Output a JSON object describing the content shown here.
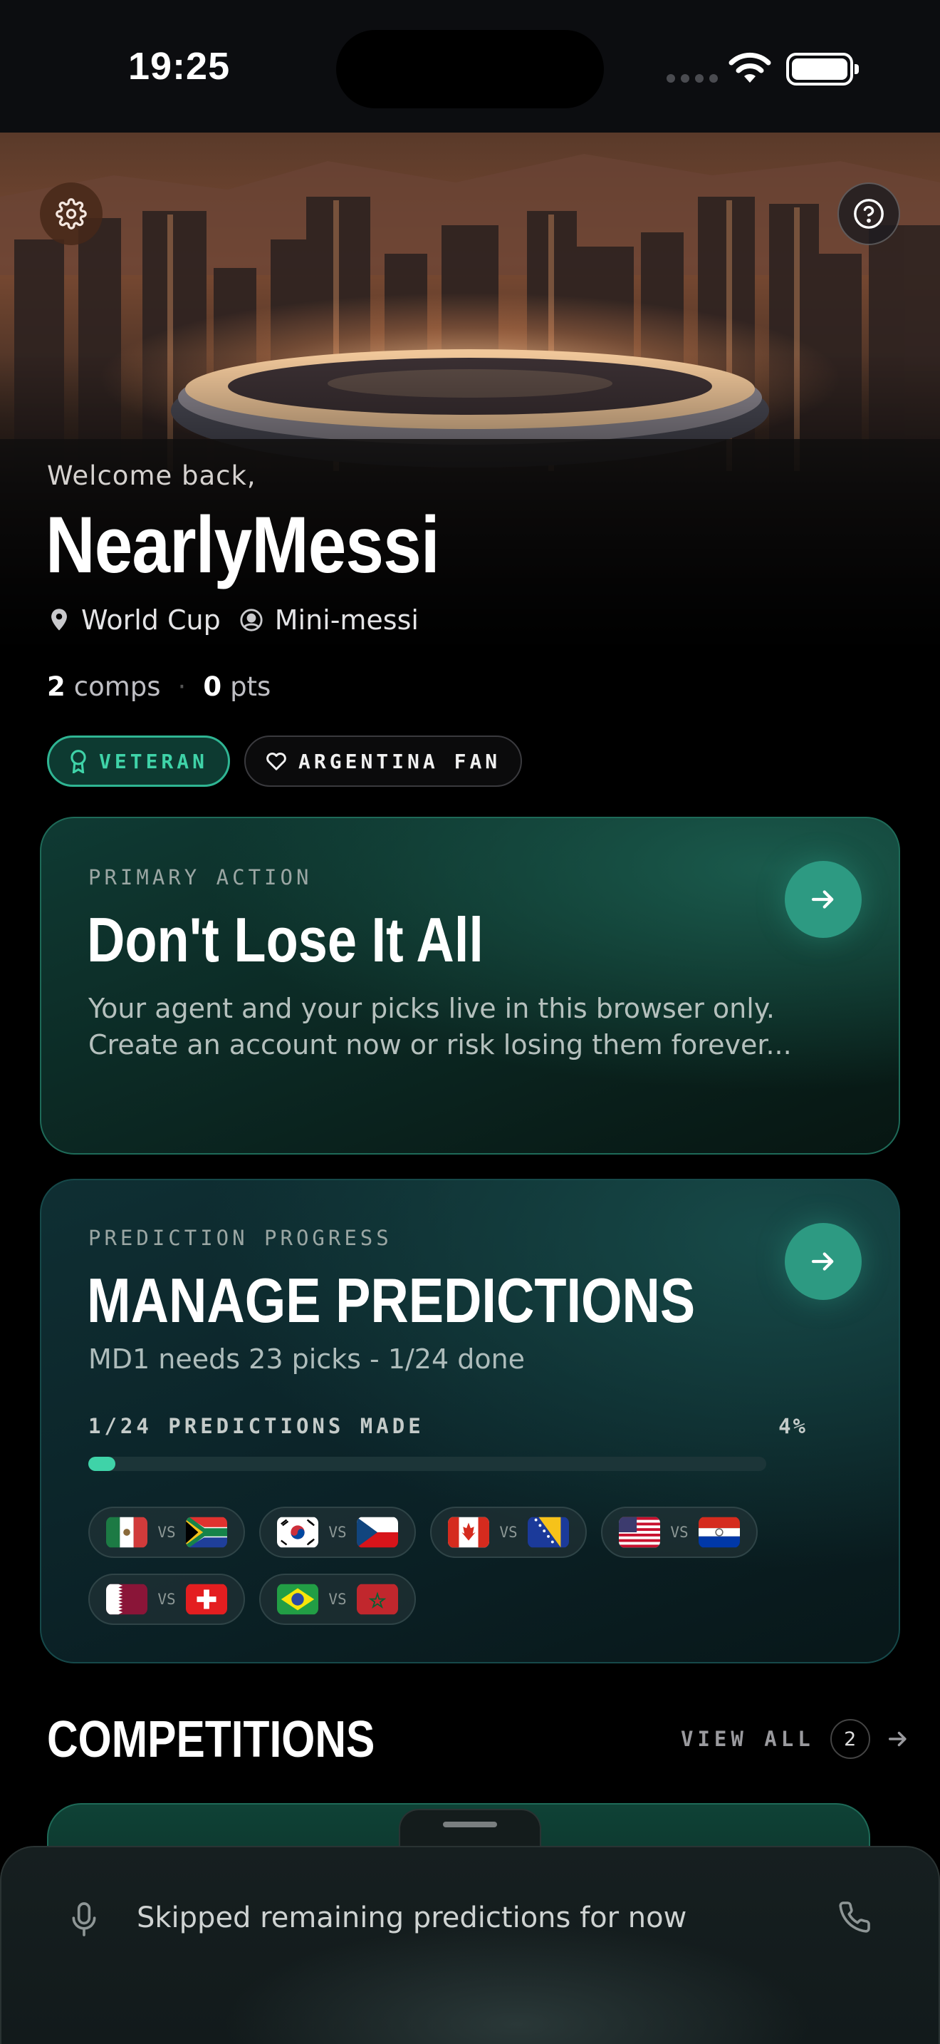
{
  "status_bar": {
    "time": "19:25"
  },
  "header": {
    "welcome": "Welcome back,",
    "username": "NearlyMessi",
    "location": "World Cup",
    "role": "Mini-messi"
  },
  "stats": {
    "comps_value": "2",
    "comps_label": "comps",
    "pts_value": "0",
    "pts_label": "pts"
  },
  "badges": [
    {
      "label": "VETERAN",
      "icon": "award-icon"
    },
    {
      "label": "ARGENTINA FAN",
      "icon": "heart-icon"
    }
  ],
  "primary_card": {
    "kicker": "PRIMARY ACTION",
    "title": "Don't Lose It All",
    "body": "Your agent and your picks live in this browser only. Create an account now or risk losing them forever..."
  },
  "prediction_card": {
    "kicker": "PREDICTION PROGRESS",
    "title": "MANAGE PREDICTIONS",
    "subtitle": "MD1 needs 23 picks - 1/24 done",
    "progress_label": "1/24 PREDICTIONS MADE",
    "progress_percent": "4%",
    "progress_fraction": 0.04,
    "vs_label": "VS",
    "matches": [
      {
        "home": "Mexico",
        "away": "South Africa"
      },
      {
        "home": "South Korea",
        "away": "Czech Republic"
      },
      {
        "home": "Canada",
        "away": "Bosnia and Herzegovina"
      },
      {
        "home": "United States",
        "away": "Paraguay"
      },
      {
        "home": "Qatar",
        "away": "Switzerland"
      },
      {
        "home": "Brazil",
        "away": "Morocco"
      }
    ]
  },
  "competitions": {
    "title": "COMPETITIONS",
    "view_all": "VIEW ALL",
    "count": "2"
  },
  "bottom_sheet": {
    "message": "Skipped remaining predictions for now"
  },
  "colors": {
    "accent": "#3fd3a8",
    "button": "#2d9a82",
    "background": "#000000"
  }
}
